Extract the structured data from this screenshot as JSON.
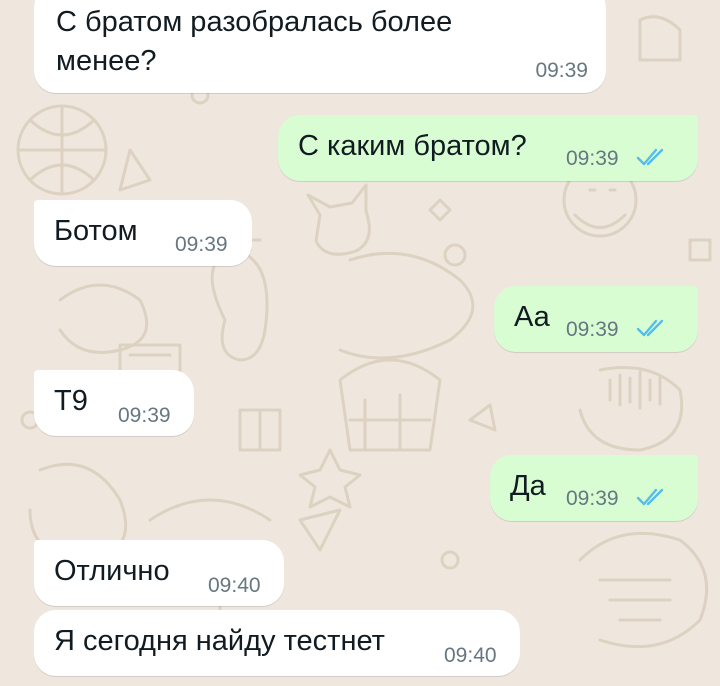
{
  "messages": [
    {
      "id": "m1",
      "direction": "incoming",
      "text_lines": [
        "С братом разобралась более",
        "менее?"
      ],
      "time": "09:39"
    },
    {
      "id": "m2",
      "direction": "outgoing",
      "text": "С каким братом?",
      "time": "09:39",
      "status": "read"
    },
    {
      "id": "m3",
      "direction": "incoming",
      "text": "Ботом",
      "time": "09:39"
    },
    {
      "id": "m4",
      "direction": "outgoing",
      "text": "Аа",
      "time": "09:39",
      "status": "read"
    },
    {
      "id": "m5",
      "direction": "incoming",
      "text": "Т9",
      "time": "09:39"
    },
    {
      "id": "m6",
      "direction": "outgoing",
      "text": "Да",
      "time": "09:39",
      "status": "read"
    },
    {
      "id": "m7",
      "direction": "incoming",
      "text": "Отлично",
      "time": "09:40"
    },
    {
      "id": "m8",
      "direction": "incoming",
      "text": "Я сегодня найду тестнет",
      "time": "09:40"
    }
  ],
  "colors": {
    "wallpaper": "#efe7dd",
    "wallpaper_doodle": "#dfd4c4",
    "incoming_bubble": "#ffffff",
    "outgoing_bubble": "#d9fdd3",
    "read_ticks": "#53bdeb",
    "timestamp": "#667781"
  },
  "icons": {
    "read_status": "double-check-icon"
  }
}
